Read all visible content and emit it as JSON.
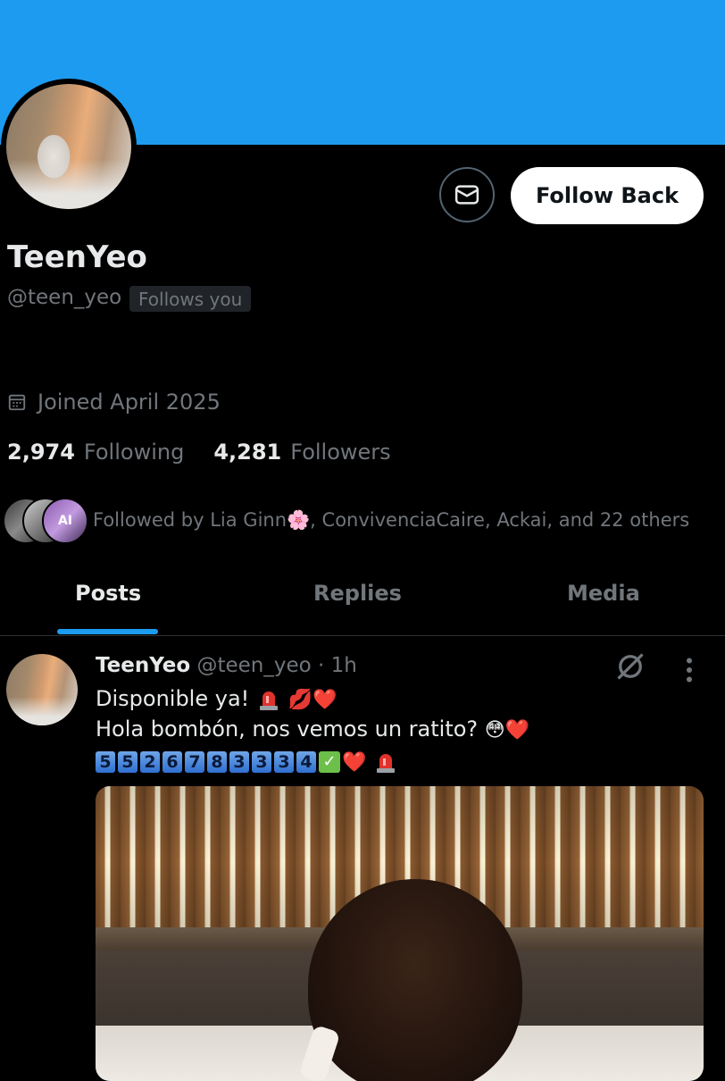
{
  "profile": {
    "name": "TeenYeo",
    "handle": "@teen_yeo",
    "follows_you_badge": "Follows you",
    "joined": "Joined April 2025",
    "following_count": "2,974",
    "following_label": "Following",
    "followers_count": "4,281",
    "followers_label": "Followers",
    "followed_by": "Followed by Lia Ginn🌸, ConvivenciaCaire, Ackai, and 22 others",
    "fb_avatar3_text": "AI"
  },
  "actions": {
    "message_icon": "envelope-icon",
    "follow_back_label": "Follow Back"
  },
  "tabs": [
    {
      "label": "Posts",
      "active": true
    },
    {
      "label": "Replies",
      "active": false
    },
    {
      "label": "Media",
      "active": false
    }
  ],
  "post": {
    "author_name": "TeenYeo",
    "author_handle": "@teen_yeo",
    "time": "· 1h",
    "line1_text": "Disponible ya!",
    "line1_emojis": "💋❤️",
    "line2_text": "Hola bombón, nos vemos un ratito?",
    "line2_emojis": "😳❤️",
    "phone_digits": [
      "5",
      "5",
      "2",
      "6",
      "7",
      "8",
      "3",
      "3",
      "3",
      "4"
    ],
    "line3_emojis": "❤️"
  },
  "colors": {
    "accent": "#1d9bf0",
    "background": "#000000",
    "muted_text": "#71767b",
    "primary_text": "#e7e9ea"
  }
}
